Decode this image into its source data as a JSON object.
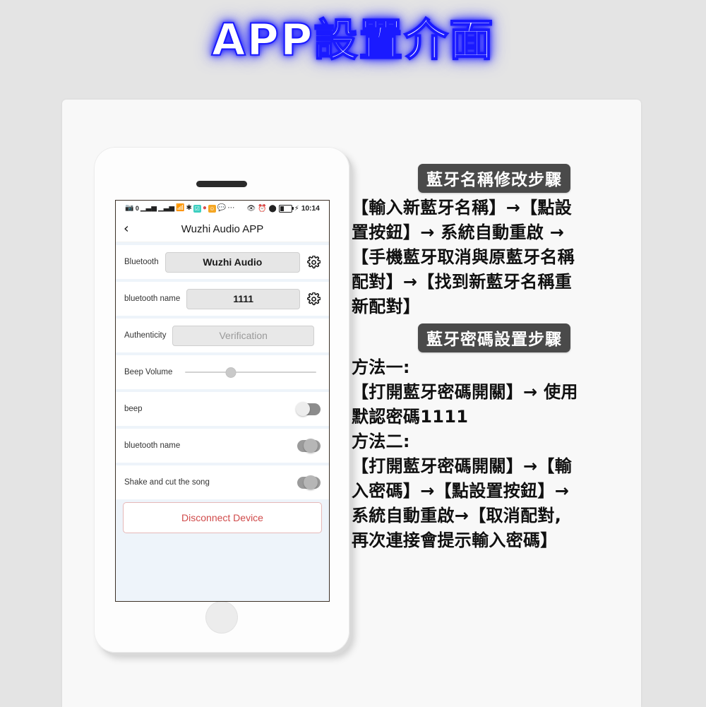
{
  "title": "APP設置介面",
  "phone": {
    "statusbar": {
      "left_icons": [
        "sim-icon",
        "signal-1-icon",
        "signal-2-icon",
        "wifi-icon",
        "location-off-icon",
        "app-green-icon",
        "qq-icon",
        "app-orange-icon",
        "message-icon",
        "more-icon"
      ],
      "sim_count": "0",
      "right_icons": [
        "eye-icon",
        "alarm-icon",
        "bluetooth-icon",
        "battery-icon",
        "charging-icon"
      ],
      "time": "10:14"
    },
    "navbar": {
      "back_icon": "chevron-left-icon",
      "title": "Wuzhi Audio APP"
    },
    "rows": [
      {
        "label": "Bluetooth",
        "value": "Wuzhi Audio",
        "control": "field-gear",
        "placeholder": false
      },
      {
        "label": "bluetooth name",
        "value": "1111",
        "control": "field-gear",
        "placeholder": false
      },
      {
        "label": "Authenticity",
        "value": "Verification",
        "control": "field",
        "placeholder": true
      },
      {
        "label": "Beep Volume",
        "value": "35",
        "control": "slider",
        "placeholder": false
      },
      {
        "label": "beep",
        "value": "off",
        "control": "toggle",
        "placeholder": false
      },
      {
        "label": "bluetooth name",
        "value": "off",
        "control": "toggle",
        "placeholder": false
      },
      {
        "label": "Shake and cut the song",
        "value": "off",
        "control": "toggle",
        "placeholder": false
      }
    ],
    "disconnect_label": "Disconnect Device"
  },
  "instructions": {
    "section1": {
      "badge": "藍牙名稱修改步驟",
      "lines": [
        "【輸入新藍牙名稱】→【點設",
        "置按鈕】→ 系統自動重啟 →",
        "【手機藍牙取消與原藍牙名稱",
        "配對】→【找到新藍牙名稱重",
        "新配對】"
      ]
    },
    "section2": {
      "badge": "藍牙密碼設置步驟",
      "lines": [
        "方法一:",
        "【打開藍牙密碼開關】→ 使用",
        "默認密碼1111",
        "方法二:",
        "【打開藍牙密碼開關】→【輸",
        "入密碼】→【點設置按鈕】→",
        "系統自動重啟→【取消配對,",
        "再次連接會提示輸入密碼】"
      ]
    }
  },
  "colors": {
    "background": "#e4e4e4",
    "card": "#f8f8f8",
    "title_glow": "#2b2bff",
    "badge_bg": "#4a4a4a",
    "disconnect_text": "#d04a4a",
    "screen_bg": "#eef4fa"
  }
}
